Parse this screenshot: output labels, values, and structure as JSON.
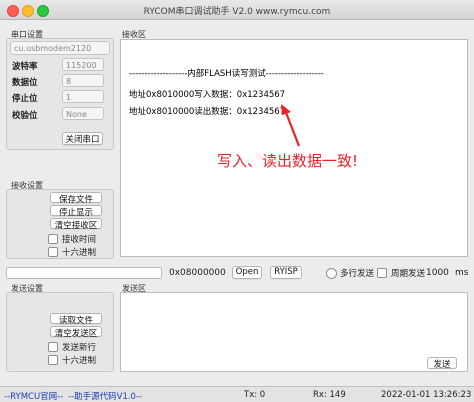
{
  "window": {
    "title": "RYCOM串口调试助手 V2.0 www.rymcu.com"
  },
  "serial": {
    "group_label": "串口设置",
    "port_value": "cu.usbmodem2120",
    "baud_label": "波特率",
    "baud_value": "115200",
    "databits_label": "数据位",
    "databits_value": "8",
    "stopbits_label": "停止位",
    "stopbits_value": "1",
    "parity_label": "校验位",
    "parity_value": "None",
    "close_button": "关闭串口"
  },
  "receive_area": {
    "label": "接收区",
    "lines": [
      "-------------------内部FLASH读写测试-------------------",
      "地址0x8010000写入数据：0x1234567",
      "地址0x8010000读出数据：0x1234567"
    ],
    "annotation": "写入、读出数据一致!"
  },
  "receive_settings": {
    "group_label": "接收设置",
    "save_file": "保存文件",
    "stop_display": "停止显示",
    "clear_recv": "清空接收区",
    "recv_time": "接收时间",
    "hex": "十六进制"
  },
  "midbar": {
    "address_value": "0x08000000",
    "open_button": "Open",
    "ryisp_button": "RYISP",
    "multi_send": "多行发送",
    "cycle_send": "周期发送",
    "period_value": "1000",
    "unit": "ms"
  },
  "send_settings": {
    "group_label": "发送设置",
    "read_file": "读取文件",
    "clear_send": "清空发送区",
    "send_newline": "发送新行",
    "hex": "十六进制"
  },
  "send_area": {
    "label": "发送区",
    "send_button": "发送"
  },
  "status": {
    "website": "--RYMCU官网--",
    "source": "--助手源代码V1.0--",
    "tx": "Tx: 0",
    "rx": "Rx: 149",
    "time": "2022-01-01 13:26:23"
  },
  "colors": {
    "annotation": "#e8222a",
    "arrow": "#e8222a",
    "link": "#1a3fb8"
  }
}
